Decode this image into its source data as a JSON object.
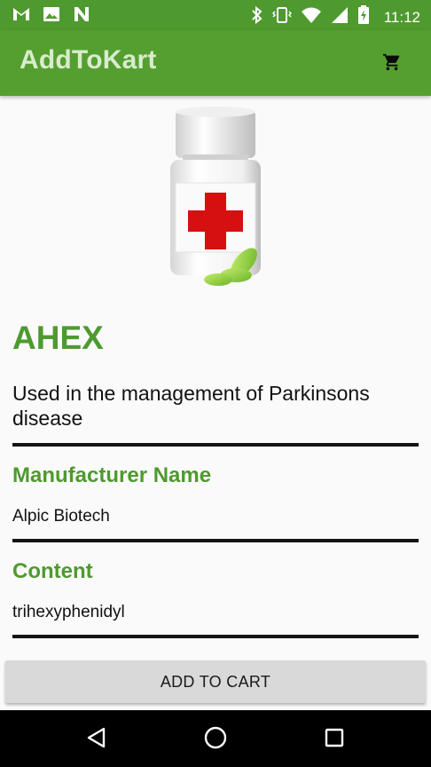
{
  "status_bar": {
    "time": "11:12",
    "left_icons": [
      "gmail-icon",
      "gallery-icon",
      "n-app-icon"
    ],
    "right_icons": [
      "bluetooth-icon",
      "vibrate-icon",
      "wifi-icon",
      "signal-icon",
      "battery-charging-icon"
    ]
  },
  "app_bar": {
    "title": "AddToKart",
    "cart_icon": "shopping-cart-icon"
  },
  "product": {
    "name": "AHEX",
    "description": "Used in the management of Parkinsons disease",
    "image_icon": "medicine-bottle-icon"
  },
  "details": {
    "manufacturer_label": "Manufacturer Name",
    "manufacturer_value": "Alpic Biotech",
    "content_label": "Content",
    "content_value": "trihexyphenidyl"
  },
  "actions": {
    "add_to_cart_label": "ADD TO CART"
  },
  "nav_bar": {
    "icons": [
      "back-icon",
      "home-icon",
      "recents-icon"
    ]
  },
  "colors": {
    "primary": "#559f31",
    "status_bar": "#4f9a2f",
    "accent_text": "#4f9a2f",
    "button_bg": "#d9d9d9"
  }
}
